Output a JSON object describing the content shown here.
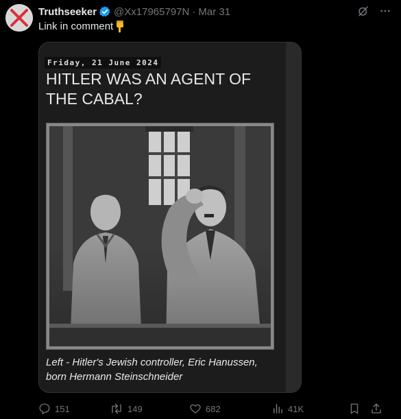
{
  "tweet": {
    "display_name": "Truthseeker",
    "handle": "@Xx17965797N",
    "separator": "·",
    "date": "Mar 31",
    "text": "Link in comment"
  },
  "media": {
    "date_line": "Friday, 21 June 2024",
    "headline": "HITLER WAS AN AGENT OF THE CABAL?",
    "caption": "Left - Hitler's Jewish controller, Eric Hanussen, born Hermann Steinschneider"
  },
  "actions": {
    "replies": "151",
    "reposts": "149",
    "likes": "682",
    "views": "41K"
  },
  "icons": {
    "avatar": "red-x-avatar",
    "verified": "verified-badge-icon",
    "grok": "grok-icon",
    "more": "more-icon",
    "emoji": "pointing-down-emoji",
    "reply": "reply-icon",
    "repost": "repost-icon",
    "like": "heart-icon",
    "views": "views-icon",
    "bookmark": "bookmark-icon",
    "share": "share-icon"
  },
  "colors": {
    "background": "#000000",
    "text": "#e7e9ea",
    "muted": "#71767b",
    "verified": "#1d9bf0",
    "avatar_x": "#d9303a"
  }
}
